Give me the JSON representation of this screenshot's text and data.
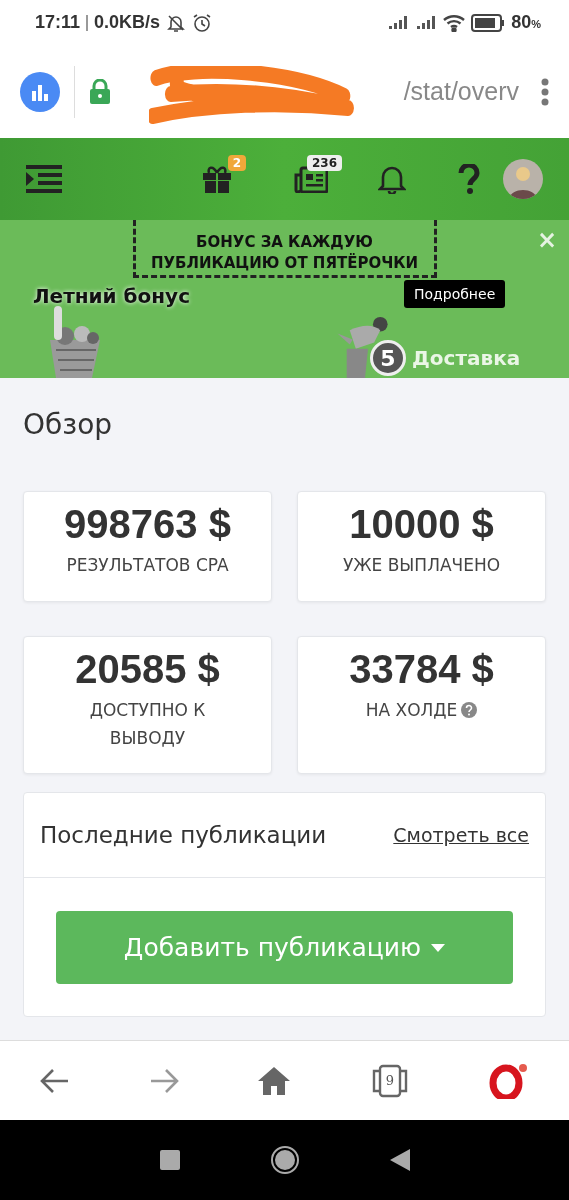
{
  "status_bar": {
    "time": "17:11",
    "speed": "0.0KB/s",
    "battery": "80",
    "battery_unit": "%"
  },
  "browser": {
    "url": "/stat/overv",
    "tab_count": "9"
  },
  "header": {
    "gift_badge": "2",
    "news_badge": "236"
  },
  "banner": {
    "headline": "БОНУС ЗА КАЖДУЮ ПУБЛИКАЦИЮ ОТ ПЯТЁРОЧКИ",
    "title": "Летний бонус",
    "button": "Подробнее",
    "logo_digit": "5",
    "logo_text": "Доставка",
    "close": "×"
  },
  "page": {
    "title": "Обзор"
  },
  "stats": [
    {
      "value": "998763 $",
      "label": "РЕЗУЛЬТАТОВ CPA",
      "info": false
    },
    {
      "value": "10000 $",
      "label": "УЖЕ ВЫПЛАЧЕНО",
      "info": false
    },
    {
      "value": "20585 $",
      "label": "ДОСТУПНО К ВЫВОДУ",
      "info": false
    },
    {
      "value": "33784 $",
      "label": "НА ХОЛДЕ",
      "info": true
    }
  ],
  "publications": {
    "title": "Последние публикации",
    "link": "Смотреть все",
    "button": "Добавить публикацию"
  }
}
